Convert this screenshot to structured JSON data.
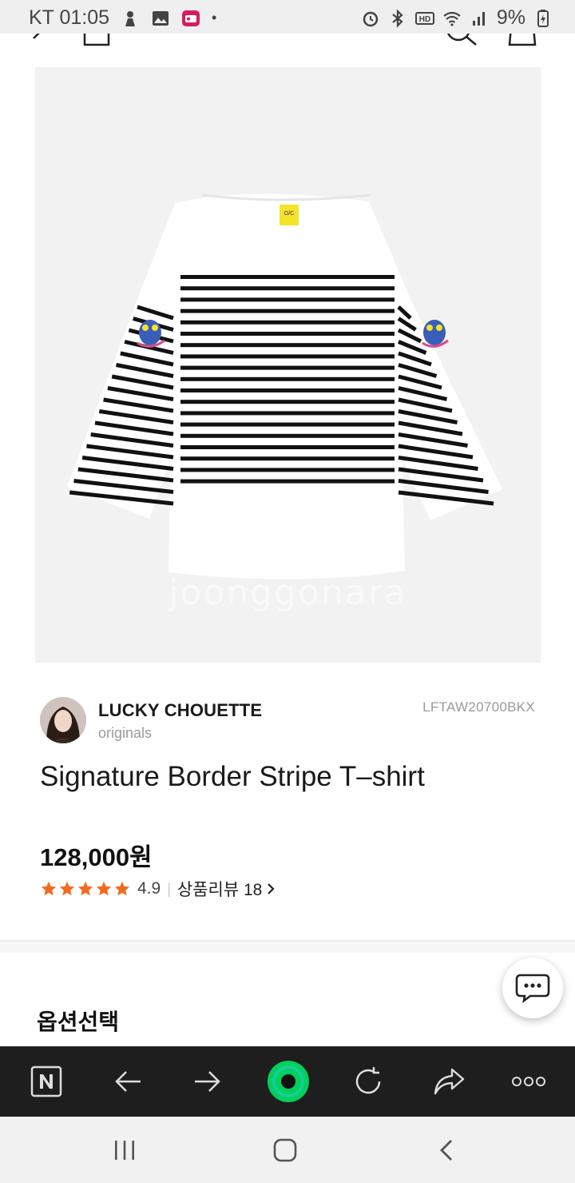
{
  "status_bar": {
    "carrier_time": "KT 01:05",
    "battery": "9%",
    "left_icons": [
      "baby-icon",
      "gallery-icon",
      "radio-app-icon",
      "dot-icon"
    ],
    "right_icons": [
      "alarm-icon",
      "bluetooth-icon",
      "hd-icon",
      "wifi-icon",
      "signal-icon",
      "battery-charging-icon"
    ]
  },
  "top_nav": {
    "icons": [
      "back-icon",
      "home-icon",
      "search-icon",
      "cart-icon"
    ]
  },
  "product": {
    "watermark": "joonggonara",
    "brand_name": "LUCKY CHOUETTE",
    "brand_sub": "originals",
    "code": "LFTAW20700BKX",
    "title": "Signature Border Stripe T–shirt",
    "price": "128,000원",
    "stars": 5,
    "rating": "4.9",
    "review_label": "상품리뷰 18",
    "colors": {
      "star": "#f26a1b",
      "stripe": "#111111",
      "tag": "#f4e22b"
    }
  },
  "options": {
    "heading": "옵션선택"
  },
  "browser_toolbar": {
    "items": [
      "naver-icon",
      "back-arrow-icon",
      "forward-arrow-icon",
      "green-dot-icon",
      "refresh-icon",
      "share-icon",
      "more-icon"
    ],
    "accent": "#03cf5d"
  },
  "android_nav": {
    "items": [
      "recent-apps-icon",
      "home-button-icon",
      "back-button-icon"
    ]
  }
}
